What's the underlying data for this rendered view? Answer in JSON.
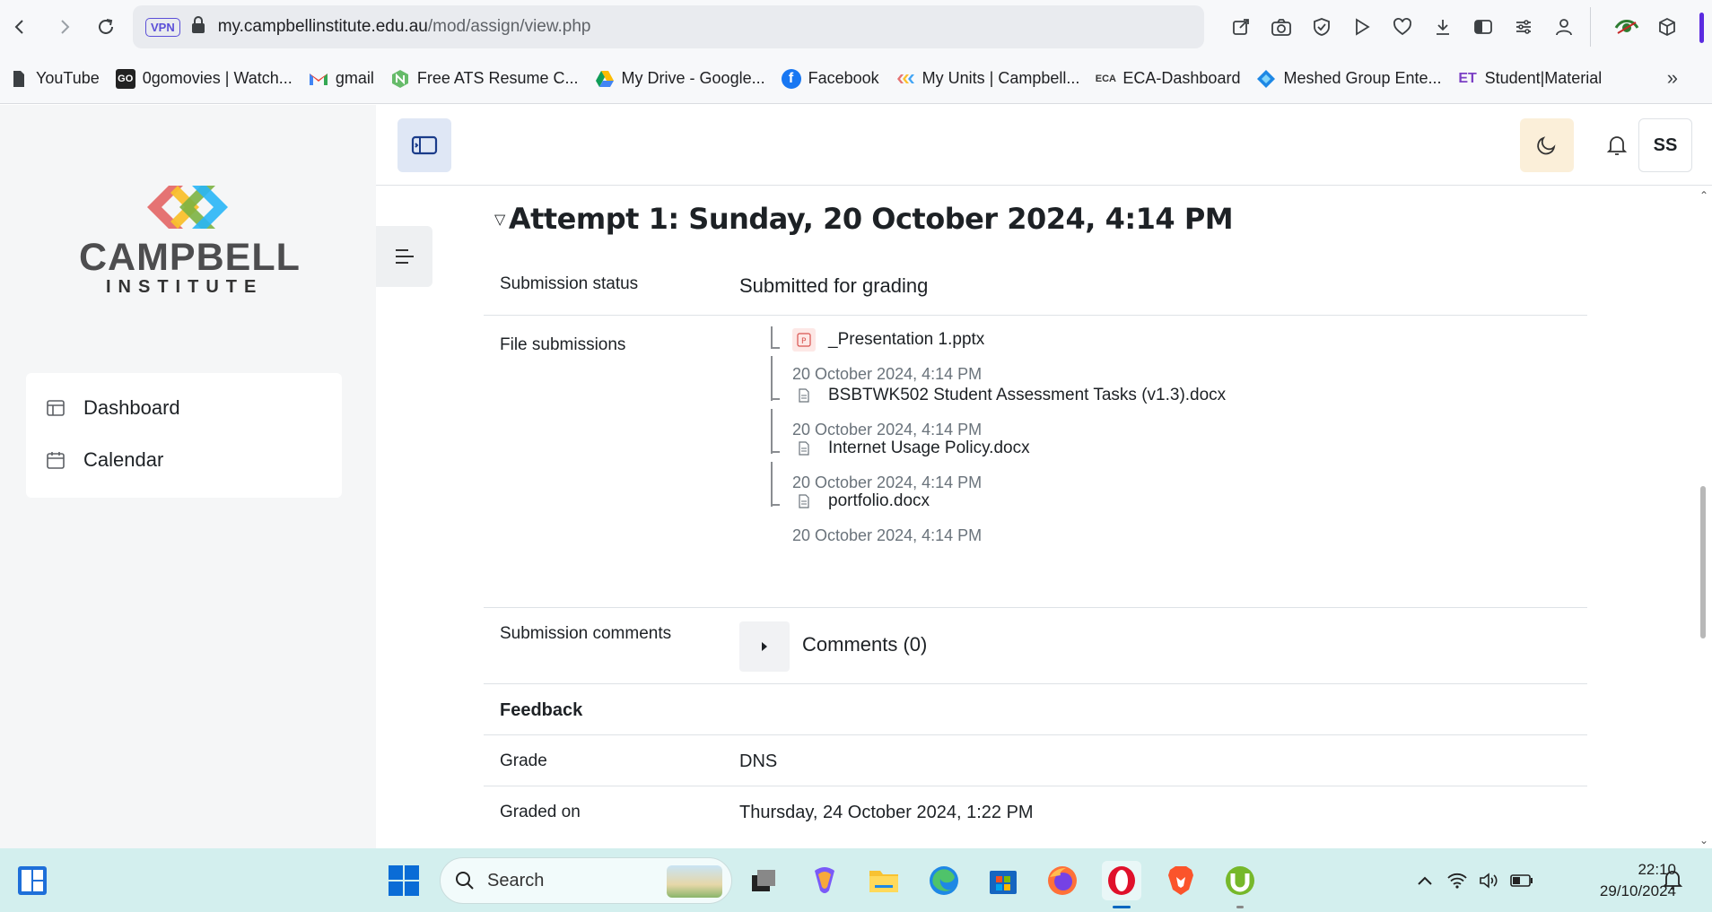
{
  "browser": {
    "url_host": "my.campbellinstitute.edu.au",
    "url_path": "/mod/assign/view.php",
    "vpn_label": "VPN"
  },
  "bookmarks": [
    {
      "label": "YouTube",
      "icon": "file-icon",
      "color": "#3c4043"
    },
    {
      "label": "0gomovies | Watch...",
      "icon": "go-icon",
      "color": "#222222"
    },
    {
      "label": "gmail",
      "icon": "gmail-icon",
      "color": "#ea4335"
    },
    {
      "label": "Free ATS Resume C...",
      "icon": "ats-icon",
      "color": "#4caf50"
    },
    {
      "label": "My Drive - Google...",
      "icon": "drive-icon",
      "color": "#1fa463"
    },
    {
      "label": "Facebook",
      "icon": "facebook-icon",
      "color": "#1877f2"
    },
    {
      "label": "My Units | Campbell...",
      "icon": "campbell-icon",
      "color": "#e0a21a"
    },
    {
      "label": "ECA-Dashboard",
      "icon": "eca-icon",
      "color": "#333333"
    },
    {
      "label": "Meshed Group Ente...",
      "icon": "meshed-icon",
      "color": "#1e88e5"
    },
    {
      "label": "Student|Material",
      "icon": "et-icon",
      "color": "#7b3fc4"
    }
  ],
  "sidebar": {
    "logo_line1": "CAMPBELL",
    "logo_line2": "INSTITUTE",
    "items": [
      {
        "label": "Dashboard",
        "icon": "dashboard-icon"
      },
      {
        "label": "Calendar",
        "icon": "calendar-icon"
      }
    ]
  },
  "header": {
    "avatar_initials": "SS"
  },
  "attempt": {
    "title": "Attempt 1: Sunday, 20 October 2024, 4:14 PM",
    "submission_status_label": "Submission status",
    "submission_status_value": "Submitted for grading",
    "file_submissions_label": "File submissions",
    "files": [
      {
        "name": "_Presentation 1.pptx",
        "date": "20 October 2024, 4:14 PM",
        "type": "pptx"
      },
      {
        "name": "BSBTWK502 Student Assessment Tasks (v1.3).docx",
        "date": "20 October 2024, 4:14 PM",
        "type": "docx"
      },
      {
        "name": "Internet Usage Policy.docx",
        "date": "20 October 2024, 4:14 PM",
        "type": "docx"
      },
      {
        "name": "portfolio.docx",
        "date": "20 October 2024, 4:14 PM",
        "type": "docx"
      }
    ],
    "submission_comments_label": "Submission comments",
    "comments_link": "Comments (0)"
  },
  "feedback": {
    "heading": "Feedback",
    "grade_label": "Grade",
    "grade_value": "DNS",
    "graded_on_label": "Graded on",
    "graded_on_value": "Thursday, 24 October 2024, 1:22 PM"
  },
  "taskbar": {
    "search_placeholder": "Search",
    "time": "22:10",
    "date": "29/10/2024"
  }
}
